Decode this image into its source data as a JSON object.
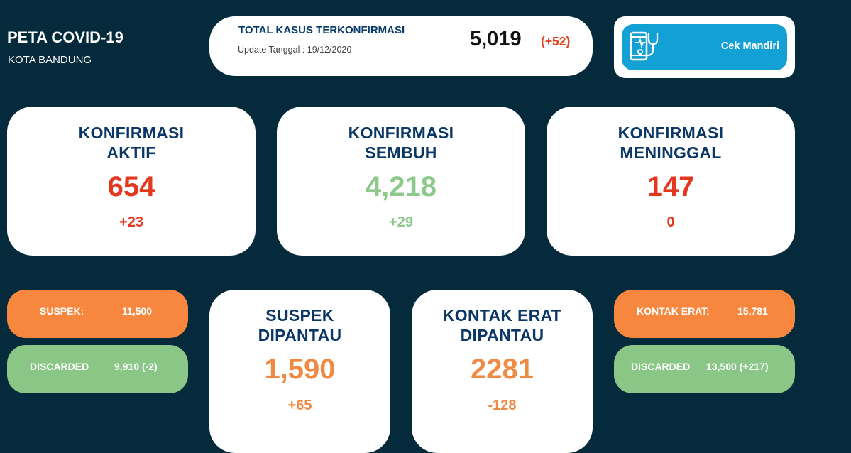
{
  "header": {
    "title": "PETA COVID-19",
    "subtitle": "KOTA BANDUNG"
  },
  "total": {
    "label": "TOTAL KASUS TERKONFIRMASI",
    "update": "Update Tanggal : 19/12/2020",
    "value": "5,019",
    "delta": "(+52)"
  },
  "cek_mandiri": {
    "label": "Cek Mandiri",
    "icon": "phone-stethoscope-icon"
  },
  "cards": {
    "aktif": {
      "title1": "KONFIRMASI",
      "title2": "AKTIF",
      "value": "654",
      "delta": "+23"
    },
    "sembuh": {
      "title1": "KONFIRMASI",
      "title2": "SEMBUH",
      "value": "4,218",
      "delta": "+29"
    },
    "meninggal": {
      "title1": "KONFIRMASI",
      "title2": "MENINGGAL",
      "value": "147",
      "delta": "0"
    },
    "suspek_dipantau": {
      "title1": "SUSPEK",
      "title2": "DIPANTAU",
      "value": "1,590",
      "delta": "+65"
    },
    "kontak_dipantau": {
      "title1": "KONTAK ERAT",
      "title2": "DIPANTAU",
      "value": "2281",
      "delta": "-128"
    }
  },
  "pills": {
    "suspek": {
      "label": "SUSPEK:",
      "value": "11,500"
    },
    "discarded_left": {
      "label": "DISCARDED",
      "value": "9,910 (-2)"
    },
    "kontak_erat": {
      "label": "KONTAK ERAT:",
      "value": "15,781"
    },
    "discarded_right": {
      "label": "DISCARDED",
      "value": "13,500 (+217)"
    }
  },
  "colors": {
    "background": "#042a3c",
    "title_blue": "#0b3767",
    "red": "#e3371e",
    "green": "#8cc98a",
    "orange": "#f08a43",
    "cek_blue": "#13a0d5"
  }
}
